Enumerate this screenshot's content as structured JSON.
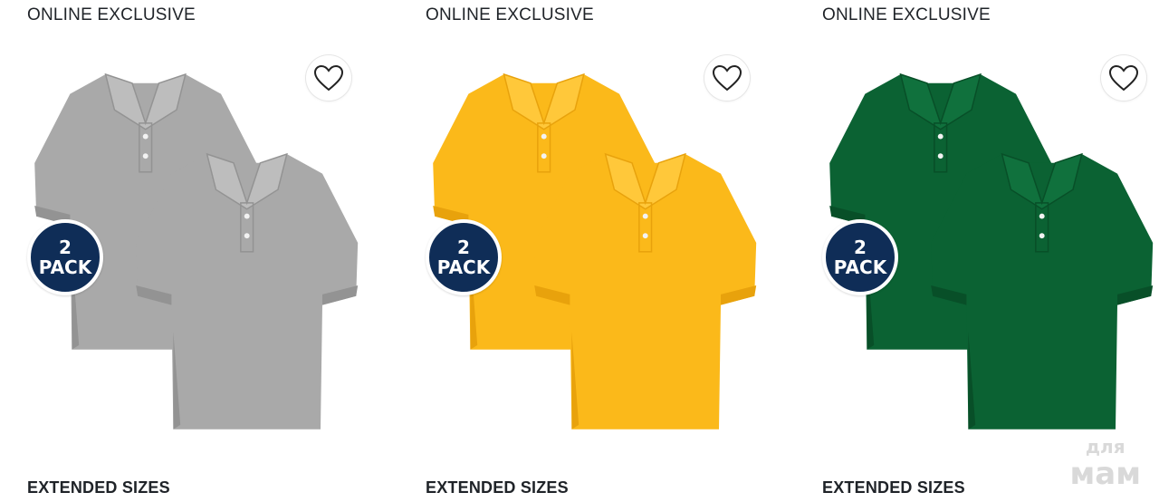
{
  "products": [
    {
      "badge": "ONLINE EXCLUSIVE",
      "pack_line1": "2",
      "pack_line2": "PACK",
      "footer": "EXTENDED SIZES",
      "shirt_color": "#a9a9a9",
      "shirt_shade": "#939393",
      "shirt_light": "#bdbdbd"
    },
    {
      "badge": "ONLINE EXCLUSIVE",
      "pack_line1": "2",
      "pack_line2": "PACK",
      "footer": "EXTENDED SIZES",
      "shirt_color": "#fbb91a",
      "shirt_shade": "#e8a20c",
      "shirt_light": "#ffc83a"
    },
    {
      "badge": "ONLINE EXCLUSIVE",
      "pack_line1": "2",
      "pack_line2": "PACK",
      "footer": "EXTENDED SIZES",
      "shirt_color": "#0b6233",
      "shirt_shade": "#084f28",
      "shirt_light": "#10713d"
    }
  ],
  "pack_badge_color": "#0f2d57",
  "watermark": {
    "line1": "для",
    "line2": "мам"
  }
}
